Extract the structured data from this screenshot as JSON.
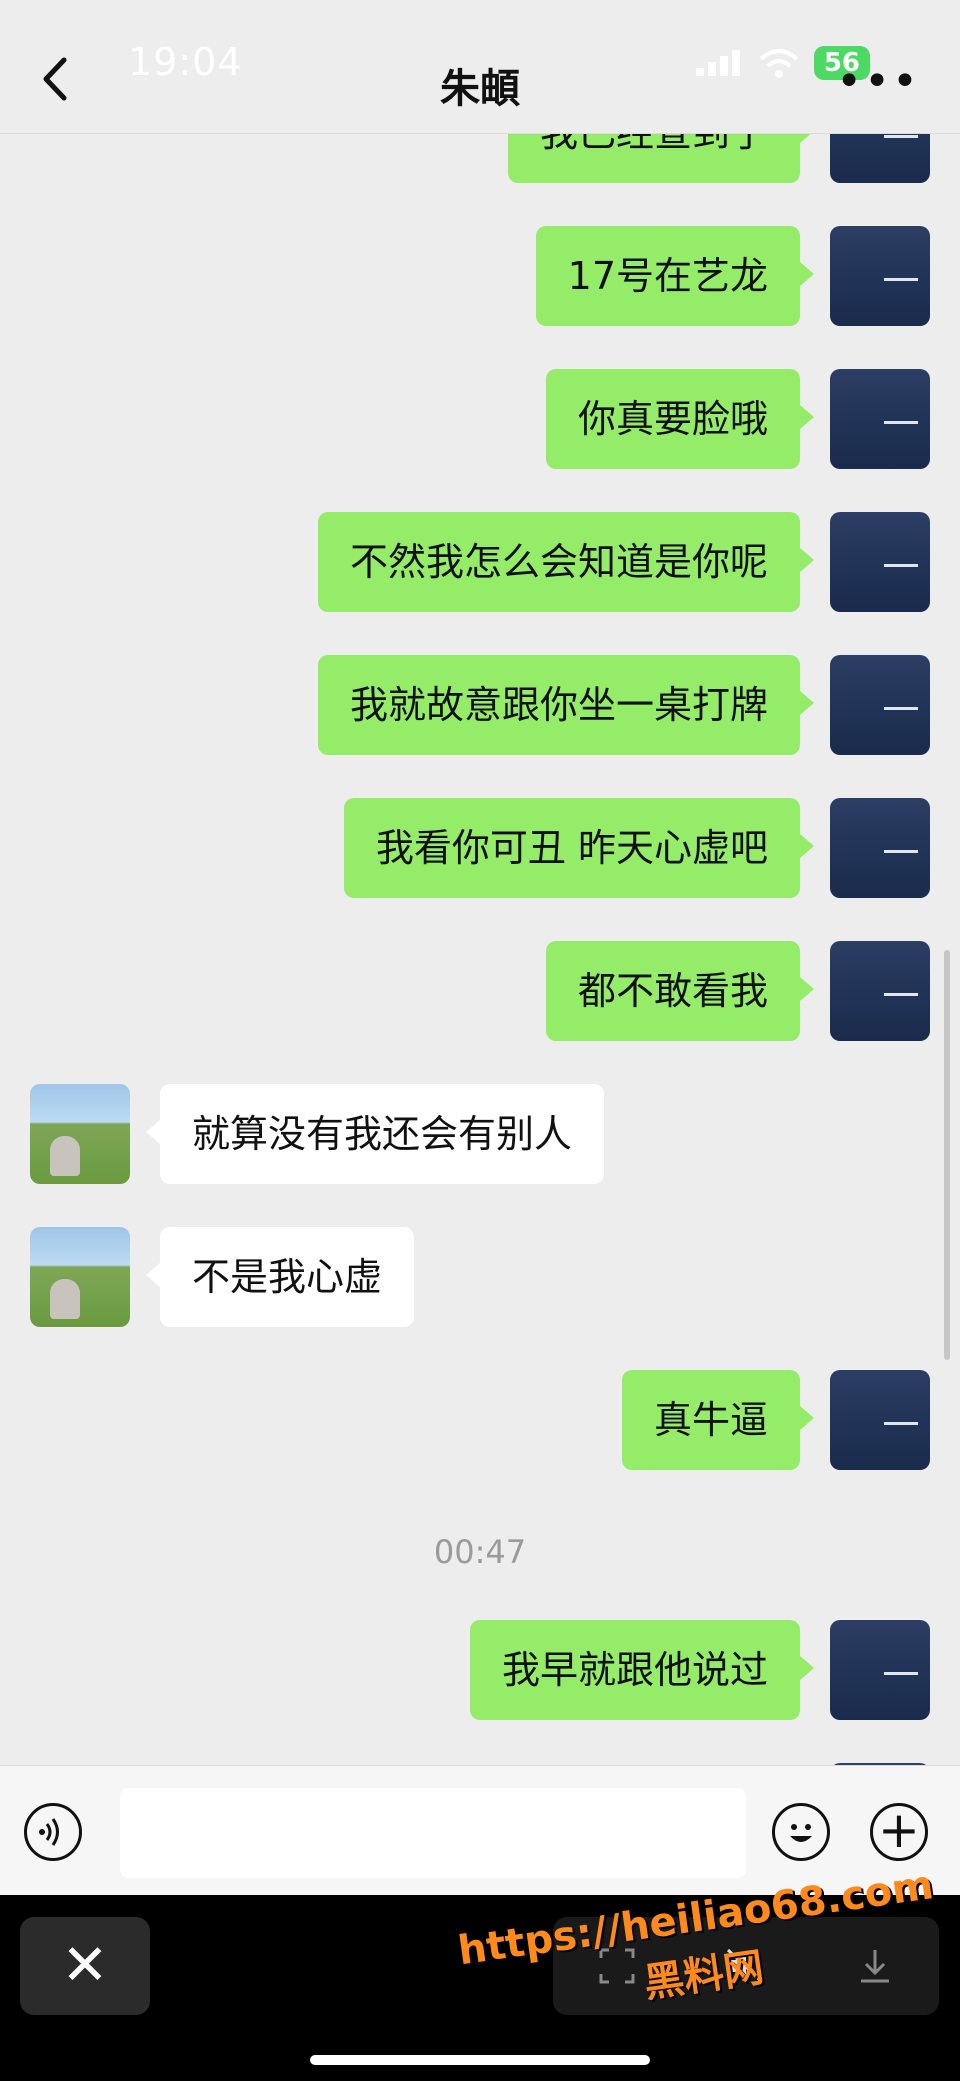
{
  "status_bar": {
    "time": "19:04",
    "battery": "56"
  },
  "header": {
    "title": "朱頔",
    "more_label": "•••"
  },
  "messages": [
    {
      "side": "right",
      "text": "我已经查到了"
    },
    {
      "side": "right",
      "text": "17号在艺龙"
    },
    {
      "side": "right",
      "text": "你真要脸哦"
    },
    {
      "side": "right",
      "text": "不然我怎么会知道是你呢"
    },
    {
      "side": "right",
      "text": "我就故意跟你坐一桌打牌"
    },
    {
      "side": "right",
      "text": "我看你可丑 昨天心虚吧"
    },
    {
      "side": "right",
      "text": "都不敢看我"
    },
    {
      "side": "left",
      "text": "就算没有我还会有别人"
    },
    {
      "side": "left",
      "text": "不是我心虚"
    },
    {
      "side": "right",
      "text": "真牛逼"
    },
    {
      "side": "right",
      "text": "我早就跟他说过"
    }
  ],
  "timestamp": "00:47",
  "input_bar": {
    "placeholder": ""
  },
  "bottom_bar": {
    "close_label": "✕"
  },
  "watermark": {
    "url": "https://heiliao68.com",
    "name": "黑料网"
  },
  "colors": {
    "my_bubble": "#95ec69",
    "their_bubble": "#ffffff",
    "background": "#ededed"
  }
}
